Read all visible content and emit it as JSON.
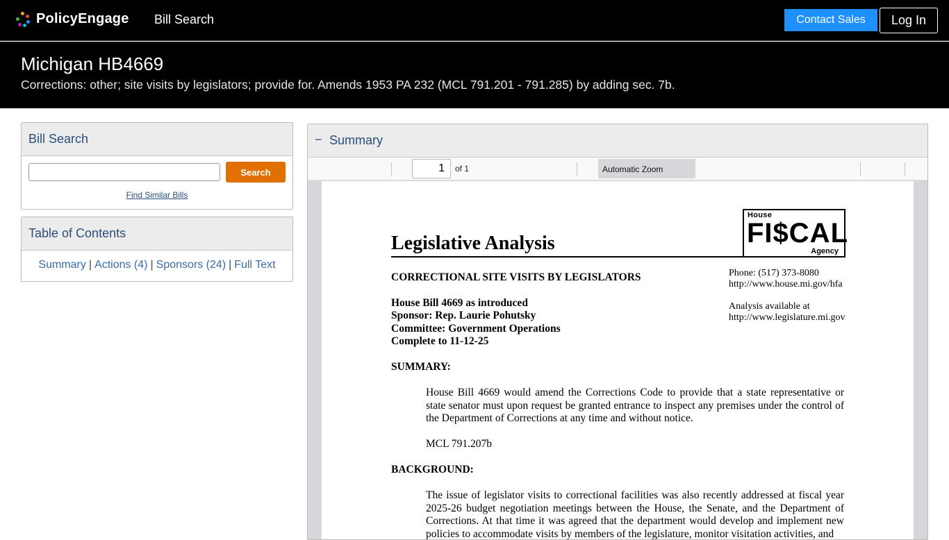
{
  "nav": {
    "brand": "PolicyEngage",
    "link": "Bill Search",
    "contact_sales": "Contact Sales",
    "login": "Log In"
  },
  "bill": {
    "title": "Michigan HB4669",
    "subtitle": "Corrections: other; site visits by legislators; provide for. Amends 1953 PA 232 (MCL 791.201 - 791.285) by adding sec. 7b."
  },
  "sidebar": {
    "search": {
      "heading": "Bill Search",
      "input_value": "",
      "button": "Search",
      "find_similar": "Find Similar Bills"
    },
    "toc": {
      "heading": "Table of Contents",
      "items": [
        "Summary",
        "Actions (4)",
        "Sponsors (24)",
        "Full Text"
      ],
      "separator": "|"
    }
  },
  "summary": {
    "collapse_icon": "−",
    "heading": "Summary",
    "viewer": {
      "page_value": "1",
      "page_of": "of 1",
      "zoom": "Automatic Zoom"
    },
    "document": {
      "logo": {
        "house": "House",
        "fiscal": "FI$CAL",
        "agency": "Agency"
      },
      "title": "Legislative Analysis",
      "topic": "CORRECTIONAL SITE VISITS BY LEGISLATORS",
      "phone": "Phone: (517) 373-8080",
      "hfa_url": "http://www.house.mi.gov/hfa",
      "analysis_available": "Analysis available at",
      "leg_url": "http://www.legislature.mi.gov",
      "bill_line": "House Bill 4669 as introduced",
      "sponsor_line": "Sponsor:  Rep. Laurie Pohutsky",
      "committee_line": "Committee:  Government Operations",
      "complete_line": "Complete to 11-12-25",
      "summary_heading": "SUMMARY:",
      "summary_text": "House Bill 4669 would amend the Corrections Code to provide that a state representative or state senator must upon request be granted entrance to inspect any premises under the control of the Department of Corrections at any time and without notice.",
      "mcl": "MCL 791.207b",
      "background_heading": "BACKGROUND:",
      "background_text": "The issue of legislator visits to correctional facilities was also recently addressed at fiscal year 2025-26 budget negotiation meetings between the House, the Senate, and the Department of Corrections. At that time it was agreed that the department would develop and implement new policies to accommodate visits by members of the legislature, monitor visitation activities, and"
    }
  },
  "colors": {
    "nav_bg": "#000000",
    "contact_button": "#1e90ff",
    "search_button": "#e07000",
    "link": "#3a6ba5",
    "panel_heading": "#2a4d7c"
  }
}
